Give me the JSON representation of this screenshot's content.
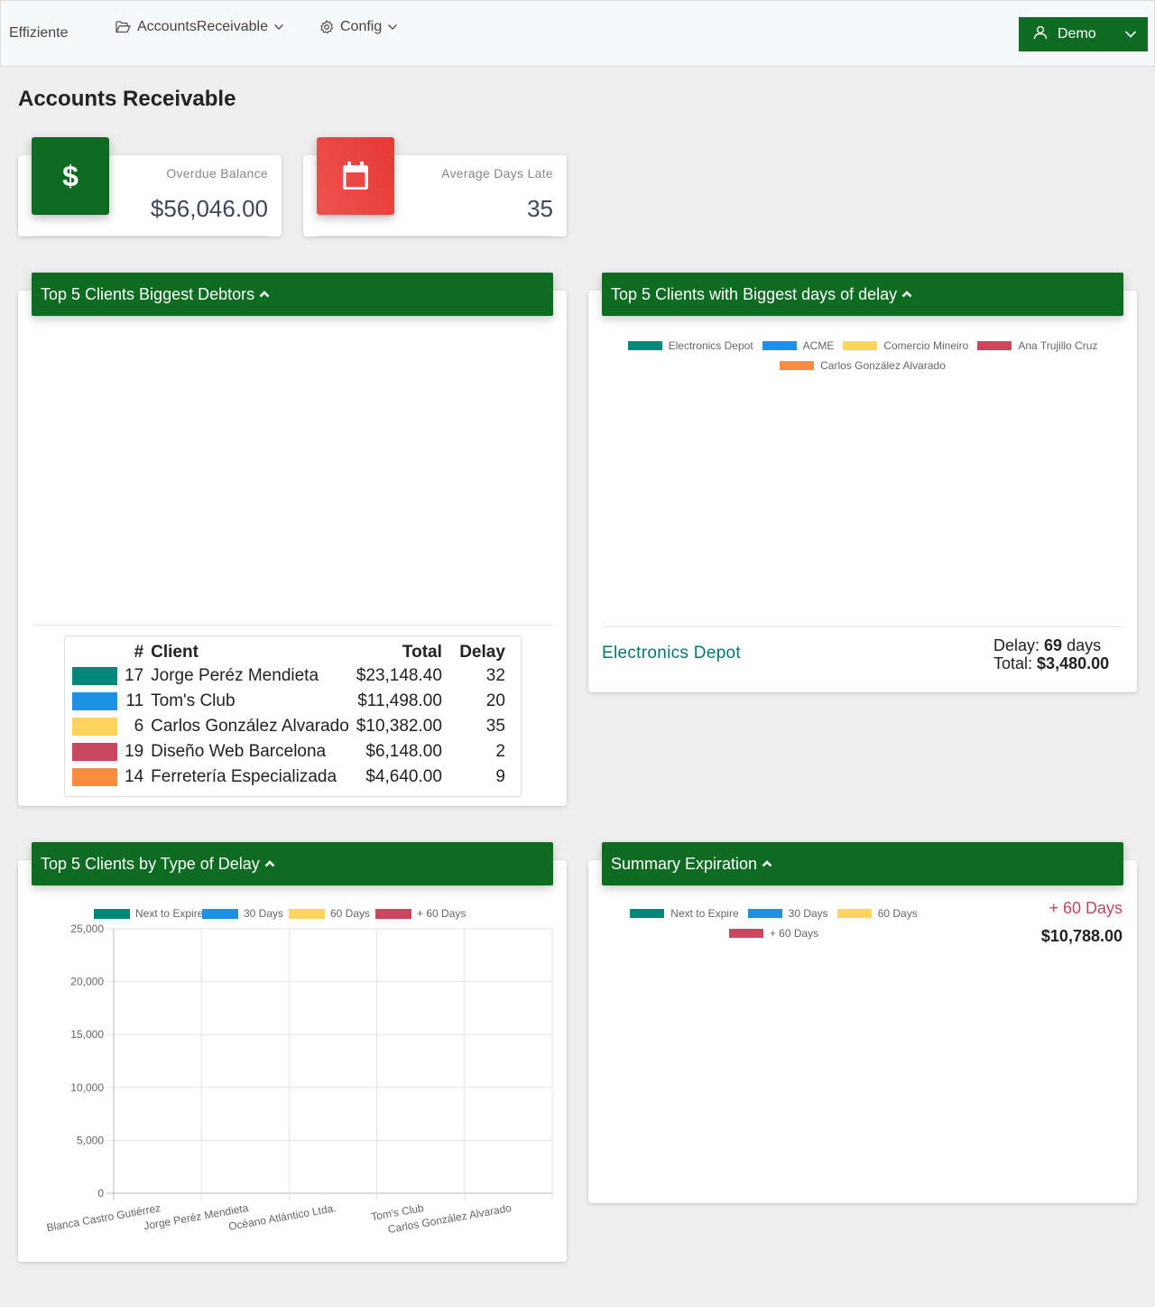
{
  "navbar": {
    "brand": "Effiziente",
    "menu_ar": "AccountsReceivable",
    "menu_config": "Config",
    "user": "Demo"
  },
  "page": {
    "title": "Accounts Receivable"
  },
  "stats": {
    "overdue_label": "Overdue Balance",
    "overdue_value": "$56,046.00",
    "days_label": "Average Days Late",
    "days_value": "35"
  },
  "colors": {
    "brand": "#0d6b22",
    "teal": "#00897b",
    "blue": "#1e90e6",
    "yellow": "#ffd45e",
    "red": "#c9485e",
    "orange": "#f78c40",
    "calendar": "#e94440"
  },
  "debtors": {
    "title": "Top 5 Clients Biggest Debtors",
    "headers": {
      "num": "#",
      "client": "Client",
      "total": "Total",
      "delay": "Delay"
    },
    "rows": [
      {
        "color": "#00897b",
        "num": "17",
        "client": "Jorge Peréz Mendieta",
        "total": "$23,148.40",
        "delay": "32"
      },
      {
        "color": "#1e90e6",
        "num": "11",
        "client": "Tom's Club",
        "total": "$11,498.00",
        "delay": "20"
      },
      {
        "color": "#ffd45e",
        "num": "6",
        "client": "Carlos González Alvarado",
        "total": "$10,382.00",
        "delay": "35"
      },
      {
        "color": "#c9485e",
        "num": "19",
        "client": "Diseño Web Barcelona",
        "total": "$6,148.00",
        "delay": "2"
      },
      {
        "color": "#f78c40",
        "num": "14",
        "client": "Ferretería Especializada",
        "total": "$4,640.00",
        "delay": "9"
      }
    ]
  },
  "delay": {
    "title": "Top 5 Clients with Biggest days of delay",
    "legend": [
      {
        "label": "Electronics Depot",
        "color": "#00897b"
      },
      {
        "label": "ACME",
        "color": "#1e90e6"
      },
      {
        "label": "Comercio Mineiro",
        "color": "#ffd45e"
      },
      {
        "label": "Ana Trujillo Cruz",
        "color": "#c9485e"
      },
      {
        "label": "Carlos González Alvarado",
        "color": "#f78c40"
      }
    ],
    "selected_client": "Electronics Depot",
    "delay_label": "Delay:",
    "delay_value": "69",
    "delay_unit": "days",
    "total_label": "Total:",
    "total_value": "$3,480.00"
  },
  "type_delay": {
    "title": "Top 5 Clients by Type of Delay"
  },
  "summary": {
    "title": "Summary Expiration",
    "legend": [
      {
        "label": "Next to Expire",
        "color": "#00897b"
      },
      {
        "label": "30 Days",
        "color": "#1e90e6"
      },
      {
        "label": "60 Days",
        "color": "#ffd45e"
      },
      {
        "label": "+ 60 Days",
        "color": "#c9485e"
      }
    ],
    "selected_label": "+ 60 Days",
    "selected_value": "$10,788.00"
  },
  "chart_data": {
    "type": "bar",
    "categories": [
      "Blanca Castro Gutiérrez",
      "Jorge Peréz Mendieta",
      "Océano Atlántico Ltda.",
      "Tom's Club",
      "Carlos González Alvarado"
    ],
    "series": [
      {
        "name": "Next to Expire",
        "color": "#00897b",
        "values": [
          0,
          0,
          0,
          0,
          0
        ]
      },
      {
        "name": "30 Days",
        "color": "#1e90e6",
        "values": [
          0,
          0,
          0,
          0,
          0
        ]
      },
      {
        "name": "60 Days",
        "color": "#ffd45e",
        "values": [
          0,
          0,
          0,
          0,
          0
        ]
      },
      {
        "name": "+ 60 Days",
        "color": "#c9485e",
        "values": [
          0,
          0,
          0,
          0,
          0
        ]
      }
    ],
    "ylim": [
      0,
      25000
    ],
    "yticks": [
      "0",
      "5,000",
      "10,000",
      "15,000",
      "20,000",
      "25,000"
    ],
    "grid": true,
    "legend_position": "top"
  }
}
